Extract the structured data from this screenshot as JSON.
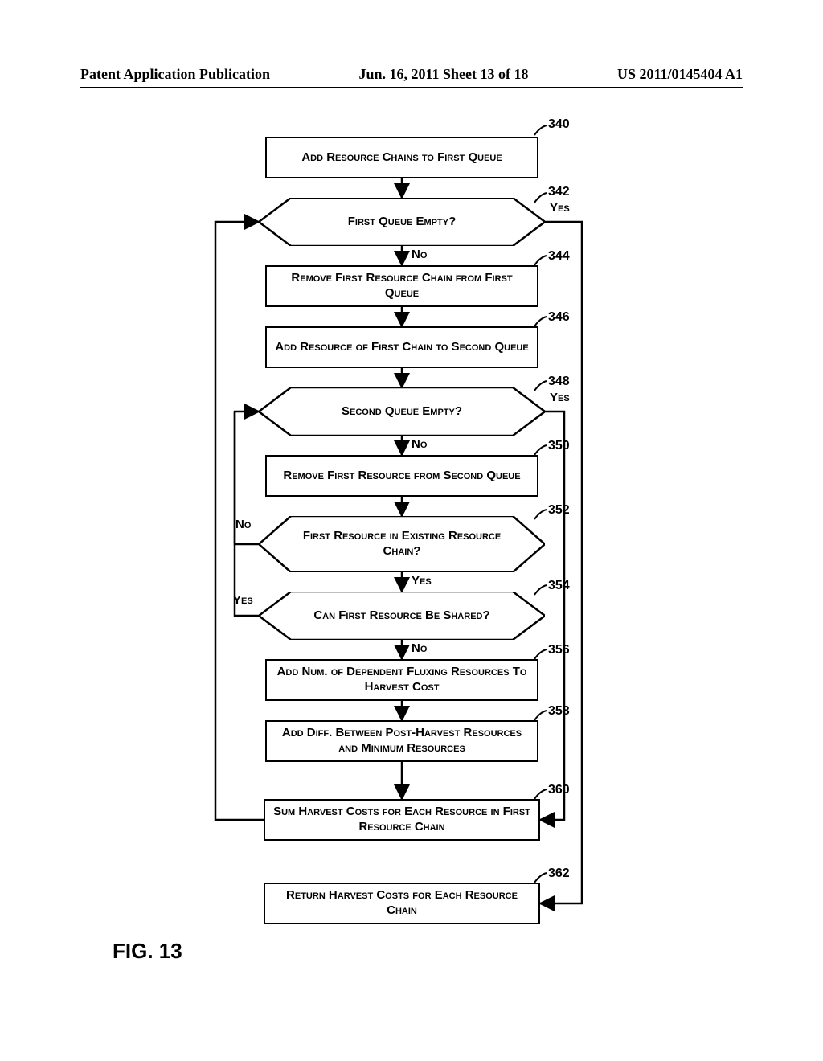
{
  "header": {
    "left": "Patent Application Publication",
    "center": "Jun. 16, 2011  Sheet 13 of 18",
    "right": "US 2011/0145404 A1"
  },
  "figure_label": "FIG. 13",
  "nodes": {
    "n340": {
      "ref": "340",
      "text": "Add Resource Chains to First Queue"
    },
    "n342": {
      "ref": "342",
      "text": "First Queue Empty?"
    },
    "n344": {
      "ref": "344",
      "text": "Remove First Resource Chain from First Queue"
    },
    "n346": {
      "ref": "346",
      "text": "Add Resource of First Chain to Second Queue"
    },
    "n348": {
      "ref": "348",
      "text": "Second Queue Empty?"
    },
    "n350": {
      "ref": "350",
      "text": "Remove First Resource from Second Queue"
    },
    "n352": {
      "ref": "352",
      "text": "First Resource in Existing Resource Chain?"
    },
    "n354": {
      "ref": "354",
      "text": "Can First Resource Be Shared?"
    },
    "n356": {
      "ref": "356",
      "text": "Add Num. of Dependent Fluxing Resources To Harvest Cost"
    },
    "n358": {
      "ref": "358",
      "text": "Add Diff. Between Post-Harvest Resources and Minimum Resources"
    },
    "n360": {
      "ref": "360",
      "text": "Sum Harvest Costs for Each Resource in First Resource Chain"
    },
    "n362": {
      "ref": "362",
      "text": "Return Harvest Costs for Each Resource Chain"
    }
  },
  "labels": {
    "yes": "Yes",
    "no": "No"
  }
}
